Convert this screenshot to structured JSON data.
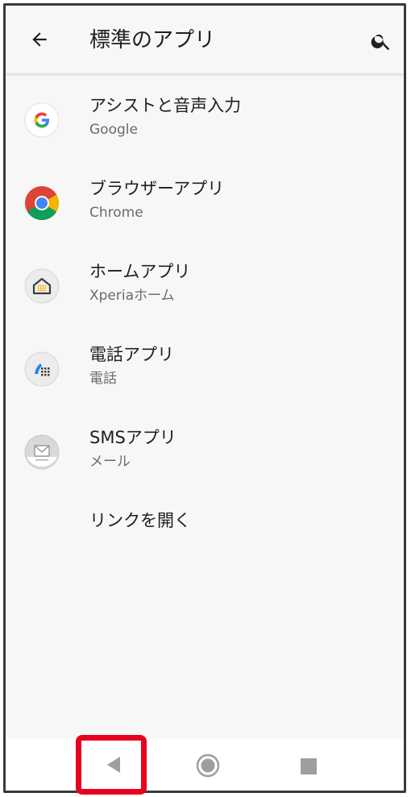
{
  "header": {
    "title": "標準のアプリ",
    "back_icon": "arrow-back-icon",
    "search_icon": "search-icon"
  },
  "items": [
    {
      "label": "アシストと音声入力",
      "value": "Google",
      "icon": "google-icon"
    },
    {
      "label": "ブラウザーアプリ",
      "value": "Chrome",
      "icon": "chrome-icon"
    },
    {
      "label": "ホームアプリ",
      "value": "Xperiaホーム",
      "icon": "home-app-icon"
    },
    {
      "label": "電話アプリ",
      "value": "電話",
      "icon": "phone-app-icon"
    },
    {
      "label": "SMSアプリ",
      "value": "メール",
      "icon": "sms-app-icon"
    },
    {
      "label": "リンクを開く"
    }
  ],
  "navbar": {
    "back_icon": "nav-back-icon",
    "home_icon": "nav-home-icon",
    "recents_icon": "nav-recents-icon"
  },
  "colors": {
    "highlight": "#e8001f",
    "background": "#f7f7f7"
  }
}
